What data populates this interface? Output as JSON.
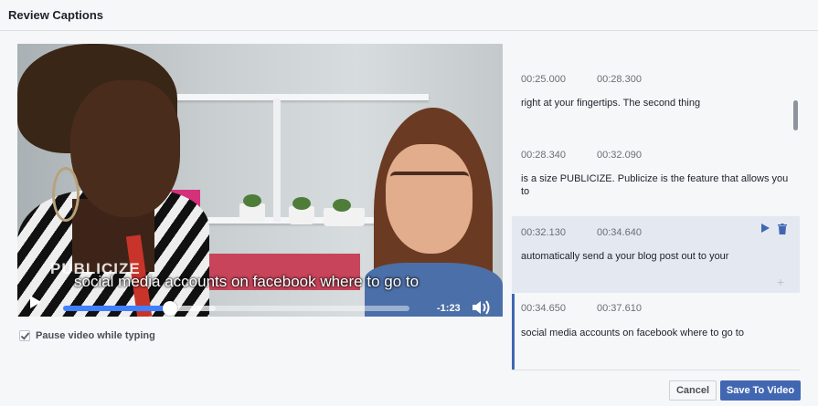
{
  "dialog": {
    "title": "Review Captions"
  },
  "video": {
    "overlay_caption": "social media accounts on facebook where to go to",
    "background_sign_text": "PUBLICIZE",
    "time_remaining": "-1:23",
    "progress_fraction": 0.31,
    "buffered_fraction": 0.44
  },
  "options": {
    "pause_while_typing_label": "Pause video while typing",
    "pause_while_typing_checked": true
  },
  "captions": [
    {
      "start": "00:25.000",
      "end": "00:28.300",
      "text": "right at your fingertips. The second thing"
    },
    {
      "start": "00:28.340",
      "end": "00:32.090",
      "text": "is a size PUBLICIZE. Publicize is the feature that allows you to"
    },
    {
      "start": "00:32.130",
      "end": "00:34.640",
      "text": "automatically send a your blog post out to your",
      "hovered": true
    },
    {
      "start": "00:34.650",
      "end": "00:37.610",
      "text": "social media accounts on facebook where to go to",
      "editing": true
    }
  ],
  "caption_actions": {
    "add_symbol": "+"
  },
  "footer": {
    "cancel_label": "Cancel",
    "save_label": "Save To Video"
  },
  "colors": {
    "accent": "#4267b2",
    "progress": "#4080ff",
    "hover_row": "#e4e8f1"
  }
}
